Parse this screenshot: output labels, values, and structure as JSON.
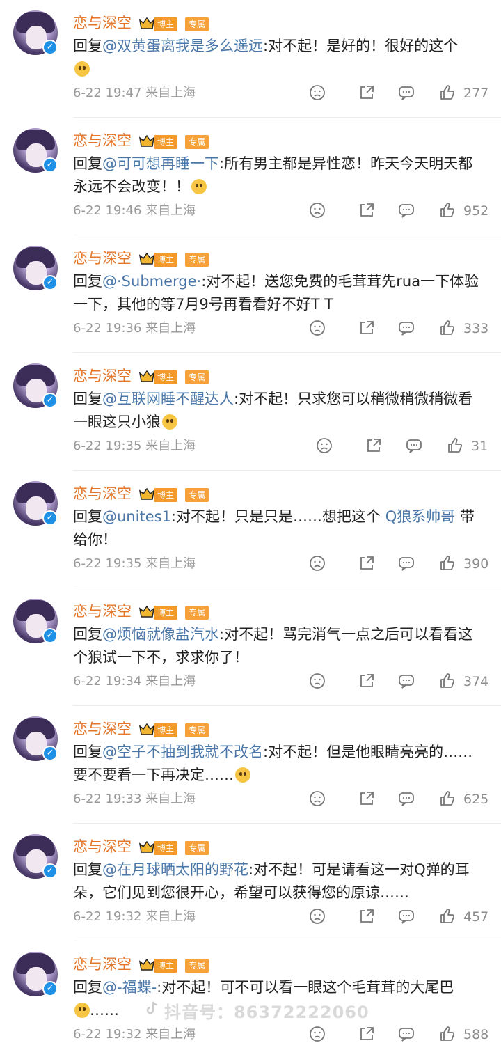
{
  "comments": [
    {
      "name": "恋与深空",
      "tag1": "博主",
      "tag2": "专属",
      "prefix": "回复",
      "mention": "@双黄蛋离我是多么遥远",
      "text": ":对不起！是好的！很好的这个",
      "time": "6-22 19:47",
      "location": "来自上海",
      "likes": "277"
    },
    {
      "name": "恋与深空",
      "tag1": "博主",
      "tag2": "专属",
      "prefix": "回复",
      "mention": "@可可想再睡一下",
      "text": ":所有男主都是异性恋！昨天今天明天都永远不会改变！！",
      "time": "6-22 19:46",
      "location": "来自上海",
      "likes": "952"
    },
    {
      "name": "恋与深空",
      "tag1": "博主",
      "tag2": "专属",
      "prefix": "回复",
      "mention": "@·Submerge·",
      "text": ":对不起！送您免费的毛茸茸先rua一下体验一下，其他的等7月9号再看看好不好T T",
      "time": "6-22 19:36",
      "location": "来自上海",
      "likes": "333"
    },
    {
      "name": "恋与深空",
      "tag1": "博主",
      "tag2": "专属",
      "prefix": "回复",
      "mention": "@互联网睡不醒达人",
      "text": ":对不起！只求您可以稍微稍微稍微看一眼这只小狼",
      "time": "6-22 19:35",
      "location": "来自上海",
      "likes": "31"
    },
    {
      "name": "恋与深空",
      "tag1": "博主",
      "tag2": "专属",
      "prefix": "回复",
      "mention": "@unites1",
      "text": ":对不起！只是只是……想把这个",
      "link": "Q狼系帅哥",
      "text2": " 带给你！",
      "time": "6-22 19:35",
      "location": "来自上海",
      "likes": "390"
    },
    {
      "name": "恋与深空",
      "tag1": "博主",
      "tag2": "专属",
      "prefix": "回复",
      "mention": "@烦恼就像盐汽水",
      "text": ":对不起！骂完消气一点之后可以看看这个狼试一下不，求求你了！",
      "time": "6-22 19:34",
      "location": "来自上海",
      "likes": "374"
    },
    {
      "name": "恋与深空",
      "tag1": "博主",
      "tag2": "专属",
      "prefix": "回复",
      "mention": "@空子不抽到我就不改名",
      "text": ":对不起！但是他眼睛亮亮的……要不要看一下再决定……",
      "time": "6-22 19:33",
      "location": "来自上海",
      "likes": "625"
    },
    {
      "name": "恋与深空",
      "tag1": "博主",
      "tag2": "专属",
      "prefix": "回复",
      "mention": "@在月球晒太阳的野花",
      "text": ":对不起！可是请看这一对Q弹的耳朵，它们见到您很开心，希望可以获得您的原谅……",
      "time": "6-22 19:32",
      "location": "来自上海",
      "likes": "457"
    },
    {
      "name": "恋与深空",
      "tag1": "博主",
      "tag2": "专属",
      "prefix": "回复",
      "mention": "@-福蝶-",
      "text": ":对不起！可不可以看一眼这个毛茸茸的大尾巴",
      "text2": "……",
      "time": "6-22 19:32",
      "location": "来自上海",
      "likes": "588"
    }
  ],
  "watermark": "抖音号：86372222060",
  "icons": {
    "dislike": "frown-face-icon",
    "share": "share-icon",
    "comment": "comment-icon",
    "like": "thumbs-up-icon"
  }
}
